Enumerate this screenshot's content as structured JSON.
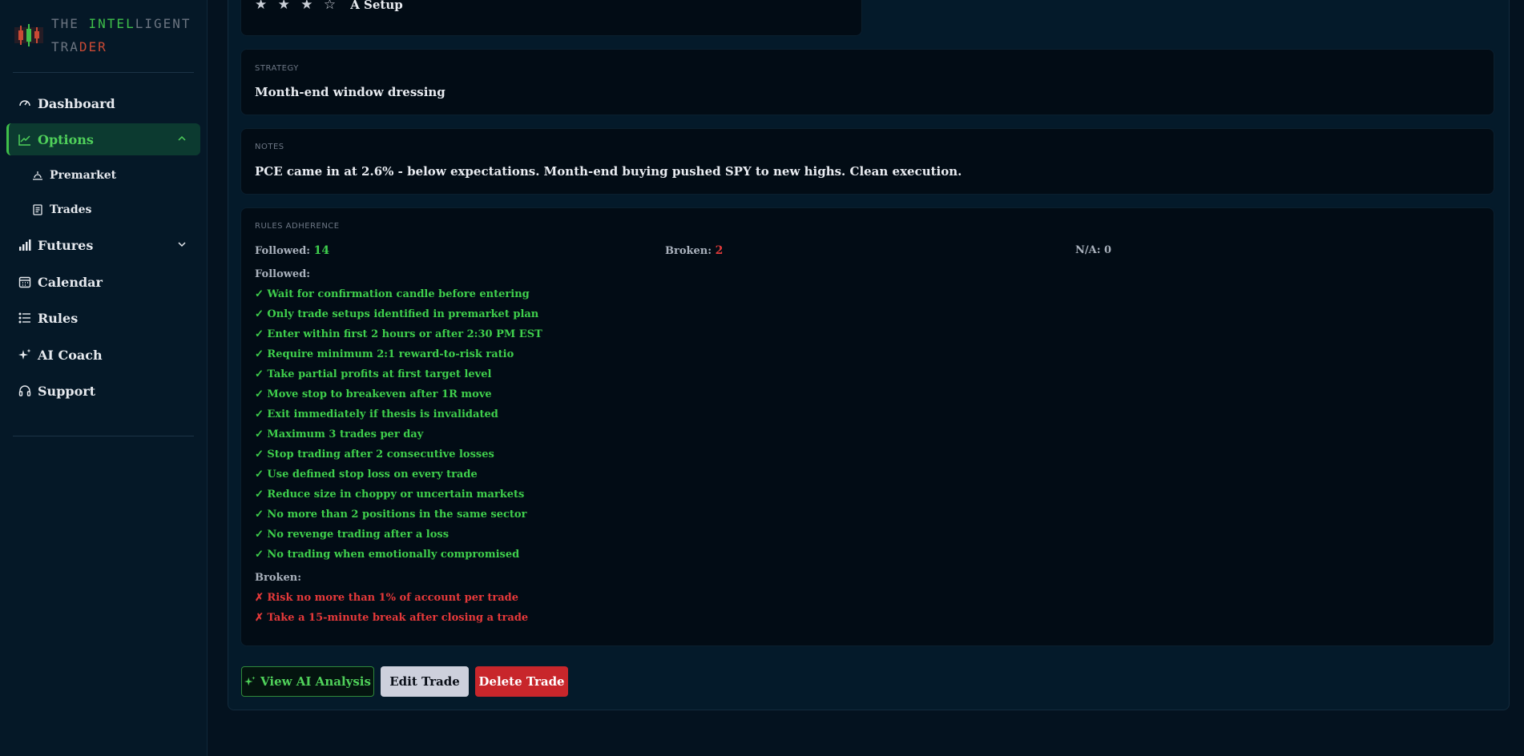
{
  "brand": {
    "line1_part1": "THE ",
    "line1_part2": "INTEL",
    "line1_part3": "LIGENT",
    "line2_part1": "TRA",
    "line2_part2": "DER"
  },
  "sidebar": {
    "items": [
      {
        "label": "Dashboard",
        "icon": "gauge-icon"
      },
      {
        "label": "Options",
        "icon": "chart-line-icon",
        "active": true,
        "expanded": true
      },
      {
        "label": "Premarket",
        "icon": "sunrise-icon"
      },
      {
        "label": "Trades",
        "icon": "receipt-icon"
      },
      {
        "label": "Futures",
        "icon": "bar-chart-icon",
        "expanded": false
      },
      {
        "label": "Calendar",
        "icon": "calendar-icon"
      },
      {
        "label": "Rules",
        "icon": "list-icon"
      },
      {
        "label": "AI Coach",
        "icon": "sparkles-icon"
      },
      {
        "label": "Support",
        "icon": "headset-icon"
      }
    ]
  },
  "trade": {
    "stars": "★ ★ ★ ☆",
    "setup_label": "A Setup",
    "strategy_label": "STRATEGY",
    "strategy_value": "Month-end window dressing",
    "notes_label": "NOTES",
    "notes_value": "PCE came in at 2.6% - below expectations. Month-end buying pushed SPY to new highs. Clean execution."
  },
  "rules": {
    "section_label": "RULES ADHERENCE",
    "followed_label": "Followed:",
    "followed_count": "14",
    "broken_label": "Broken:",
    "broken_count": "2",
    "na_label": "N/A: 0",
    "followed_heading": "Followed:",
    "followed": [
      "✓ Wait for confirmation candle before entering",
      "✓ Only trade setups identified in premarket plan",
      "✓ Enter within first 2 hours or after 2:30 PM EST",
      "✓ Require minimum 2:1 reward-to-risk ratio",
      "✓ Take partial profits at first target level",
      "✓ Move stop to breakeven after 1R move",
      "✓ Exit immediately if thesis is invalidated",
      "✓ Maximum 3 trades per day",
      "✓ Stop trading after 2 consecutive losses",
      "✓ Use defined stop loss on every trade",
      "✓ Reduce size in choppy or uncertain markets",
      "✓ No more than 2 positions in the same sector",
      "✓ No revenge trading after a loss",
      "✓ No trading when emotionally compromised"
    ],
    "broken_heading": "Broken:",
    "broken": [
      "✗ Risk no more than 1% of account per trade",
      "✗ Take a 15-minute break after closing a trade"
    ]
  },
  "actions": {
    "ai_label": "View AI Analysis",
    "edit_label": "Edit Trade",
    "delete_label": "Delete Trade"
  },
  "colors": {
    "accent_green": "#3fbf4a",
    "danger_red": "#c8262b",
    "background": "#04121f"
  }
}
